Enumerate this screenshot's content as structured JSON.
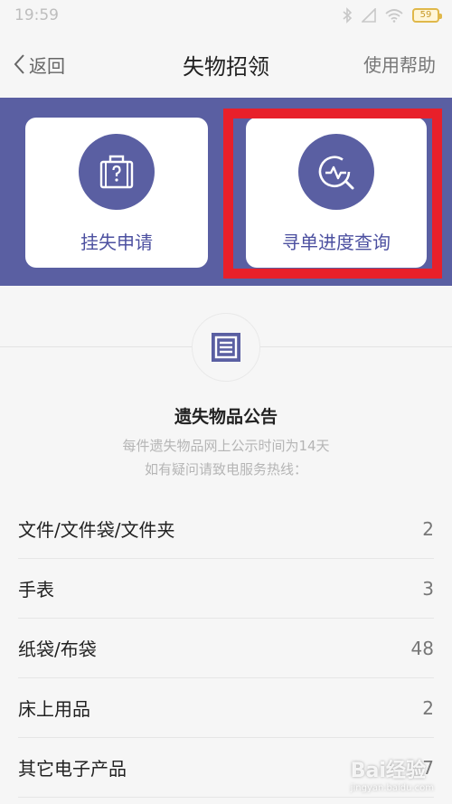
{
  "status": {
    "time": "19:59",
    "battery": "59"
  },
  "nav": {
    "back": "返回",
    "title": "失物招领",
    "help": "使用帮助"
  },
  "cards": [
    {
      "label": "挂失申请",
      "icon": "luggage-question-icon"
    },
    {
      "label": "寻单进度查询",
      "icon": "search-pulse-icon"
    }
  ],
  "notice": {
    "title": "遗失物品公告",
    "line1": "每件遗失物品网上公示时间为14天",
    "line2": "如有疑问请致电服务热线："
  },
  "items": [
    {
      "name": "文件/文件袋/文件夹",
      "count": "2"
    },
    {
      "name": "手表",
      "count": "3"
    },
    {
      "name": "纸袋/布袋",
      "count": "48"
    },
    {
      "name": "床上用品",
      "count": "2"
    },
    {
      "name": "其它电子产品",
      "count": "7"
    }
  ],
  "watermark": {
    "brand": "Bai经验",
    "url": "jingyan.baidu.com"
  },
  "colors": {
    "accent": "#5a5fa2",
    "highlight": "#e8202a"
  }
}
